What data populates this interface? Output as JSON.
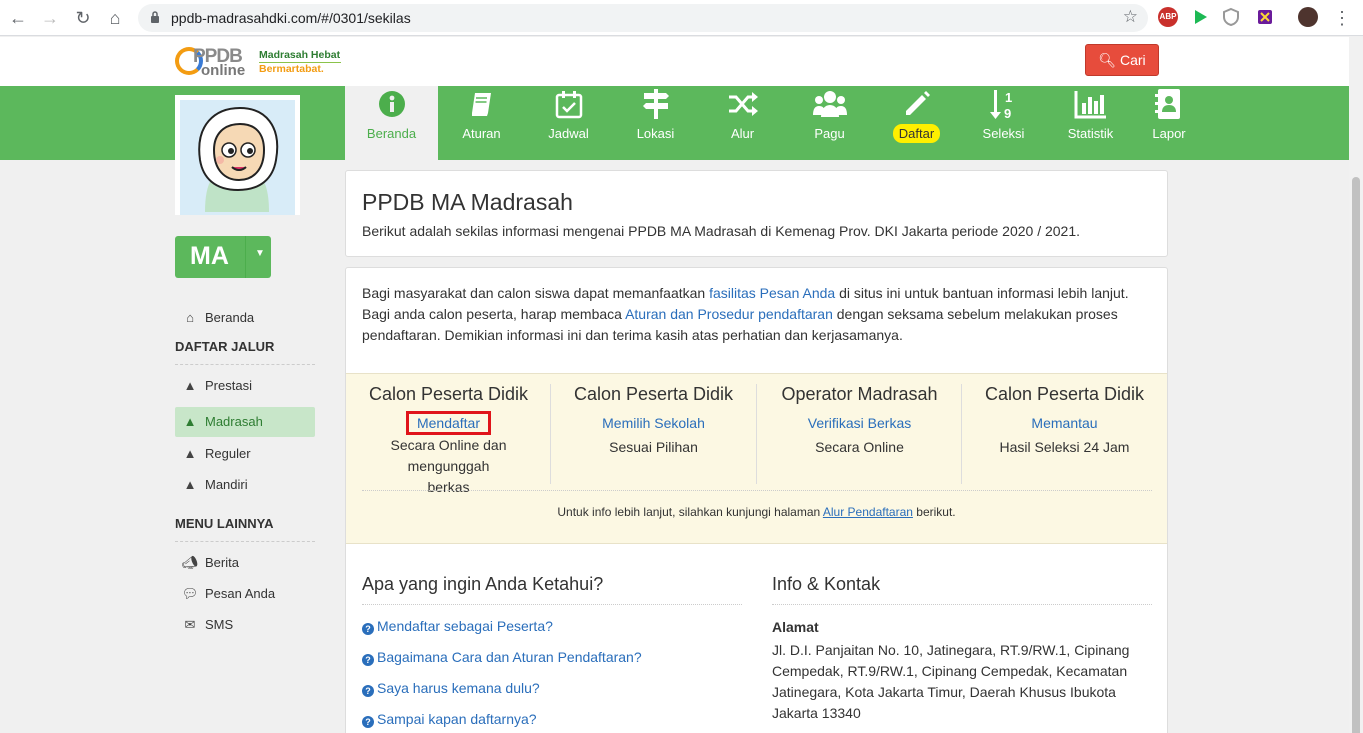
{
  "browser": {
    "url": "ppdb-madrasahdki.com/#/0301/sekilas",
    "extensions": [
      "ABP",
      "play-icon",
      "shield-icon",
      "puzzle-icon"
    ]
  },
  "header": {
    "logo_ppdb": "PPDB",
    "logo_online": "online",
    "tagline_1": "Madrasah Hebat",
    "tagline_2": "Bermartabat.",
    "search_label": "Cari"
  },
  "nav": {
    "items": [
      {
        "label": "Beranda",
        "icon": "info-icon"
      },
      {
        "label": "Aturan",
        "icon": "book-icon"
      },
      {
        "label": "Jadwal",
        "icon": "calendar-check-icon"
      },
      {
        "label": "Lokasi",
        "icon": "signpost-icon"
      },
      {
        "label": "Alur",
        "icon": "shuffle-icon"
      },
      {
        "label": "Pagu",
        "icon": "users-icon"
      },
      {
        "label": "Daftar",
        "icon": "pencil-icon"
      },
      {
        "label": "Seleksi",
        "icon": "sort-numeric-icon"
      },
      {
        "label": "Statistik",
        "icon": "bar-chart-icon"
      },
      {
        "label": "Lapor",
        "icon": "contact-book-icon"
      }
    ]
  },
  "sidebar": {
    "level_label": "MA",
    "home_label": "Beranda",
    "section1": "DAFTAR JALUR",
    "jalur": [
      "Prestasi",
      "Madrasah",
      "Reguler",
      "Mandiri"
    ],
    "section2": "MENU LAINNYA",
    "other": [
      "Berita",
      "Pesan Anda",
      "SMS"
    ]
  },
  "main": {
    "title": "PPDB MA Madrasah",
    "subtitle": "Berikut adalah sekilas informasi mengenai PPDB MA Madrasah di Kemenag Prov. DKI Jakarta periode 2020 / 2021.",
    "intro_1a": "Bagi masyarakat dan calon siswa dapat memanfaatkan ",
    "intro_1_link": "fasilitas Pesan Anda",
    "intro_1b": " di situs ini untuk bantuan informasi lebih lanjut.",
    "intro_2a": "Bagi anda calon peserta, harap membaca ",
    "intro_2_link": "Aturan dan Prosedur pendaftaran",
    "intro_2b": " dengan seksama sebelum melakukan proses pendaftaran. Demikian informasi ini dan terima kasih atas perhatian dan kerjasamanya.",
    "steps": [
      {
        "heading": "Calon Peserta Didik",
        "link": "Mendaftar",
        "desc": "Secara Online dan mengunggah berkas"
      },
      {
        "heading": "Calon Peserta Didik",
        "link": "Memilih Sekolah",
        "desc": "Sesuai Pilihan"
      },
      {
        "heading": "Operator Madrasah",
        "link": "Verifikasi Berkas",
        "desc": "Secara Online"
      },
      {
        "heading": "Calon Peserta Didik",
        "link": "Memantau",
        "desc": "Hasil Seleksi 24 Jam"
      }
    ],
    "note_a": "Untuk info lebih lanjut, silahkan kunjungi halaman ",
    "note_link": "Alur Pendaftaran",
    "note_b": " berikut.",
    "faq_title": "Apa yang ingin Anda Ketahui?",
    "faq": [
      "Mendaftar sebagai Peserta?",
      "Bagaimana Cara dan Aturan Pendaftaran?",
      "Saya harus kemana dulu?",
      "Sampai kapan daftarnya?"
    ],
    "info_title": "Info & Kontak",
    "address_label": "Alamat",
    "address": "Jl. D.I. Panjaitan No. 10, Jatinegara, RT.9/RW.1, Cipinang Cempedak, RT.9/RW.1, Cipinang Cempedak, Kecamatan Jatinegara, Kota Jakarta Timur, Daerah Khusus Ibukota Jakarta 13340"
  },
  "colors": {
    "green": "#5cb85c",
    "red_button": "#e74c3c",
    "link": "#2a6ebb",
    "highlight_yellow": "#ffef00",
    "steps_bg": "#fcf8e3"
  }
}
